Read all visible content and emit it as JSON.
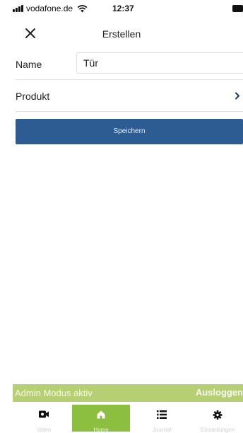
{
  "status_bar": {
    "carrier": "vodafone.de",
    "time": "12:37"
  },
  "header": {
    "title": "Erstellen",
    "close_icon": "close-icon"
  },
  "form": {
    "name_label": "Name",
    "name_value": "Tür",
    "product_label": "Produkt"
  },
  "save_button": {
    "label": "Speichern",
    "color": "#2d5c93"
  },
  "admin_bar": {
    "text": "Admin Modus aktiv",
    "logout": "Ausloggen",
    "color": "#b6cf73"
  },
  "tabs": [
    {
      "label": "Video",
      "icon": "video-camera-icon",
      "active": false
    },
    {
      "label": "Home",
      "icon": "home-icon",
      "active": true
    },
    {
      "label": "Journal",
      "icon": "list-icon",
      "active": false
    },
    {
      "label": "Einstellungen",
      "icon": "gear-icon",
      "active": false
    }
  ],
  "colors": {
    "accent_green": "#8cbf3f",
    "primary_blue": "#2d5c93"
  }
}
